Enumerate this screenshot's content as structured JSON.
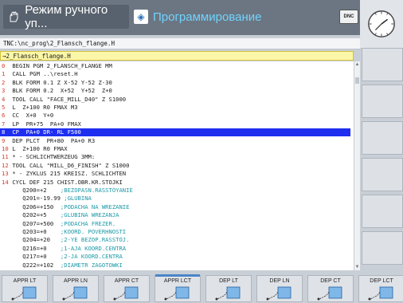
{
  "header": {
    "manual_tab": "Режим ручного уп...",
    "program_tab": "Программирование",
    "dnc": "DNC"
  },
  "path": "TNC:\\nc_prog\\2_Flansch_flange.H",
  "file": "→2_Flansch_flange.H",
  "code": [
    {
      "n": "0",
      "t": " BEGIN PGM 2_FLANSCH_FLANGE MM"
    },
    {
      "n": "1",
      "t": " CALL PGM ..\\reset.H"
    },
    {
      "n": "2",
      "t": " BLK FORM 0.1 Z X-52 Y-52 Z-30"
    },
    {
      "n": "3",
      "t": " BLK FORM 0.2  X+52  Y+52  Z+0"
    },
    {
      "n": "4",
      "t": " TOOL CALL \"FACE_MILL_D40\" Z S1000"
    },
    {
      "n": "5",
      "t": " L  Z+100 R0 FMAX M3"
    },
    {
      "n": "6",
      "t": " CC  X+0  Y+0"
    },
    {
      "n": "7",
      "t": " LP  PR+75  PA+0 FMAX"
    },
    {
      "n": "8",
      "t": " CP  PA+0 DR- RL F500"
    },
    {
      "n": "9",
      "t": " DEP PLCT  PR+80  PA+0 R3"
    },
    {
      "n": "10",
      "t": " L  Z+100 R0 FMAX"
    },
    {
      "n": "11",
      "t": " * - SCHLICHTWERZEUG 3MM:"
    },
    {
      "n": "12",
      "t": " TOOL CALL \"MILL_D6_FINISH\" Z S1000"
    },
    {
      "n": "13",
      "t": " * - ZYKLUS 215 KREISZ. SCHLICHTEN"
    },
    {
      "n": "14",
      "t": " CYCL DEF 215 CHIST.OBR.KR.STOJKI"
    },
    {
      "n": "",
      "t": "    Q200=+2    ;BEZOPASN.RASSTOYANIE"
    },
    {
      "n": "",
      "t": "    Q201=-19.99 ;GLUBINA"
    },
    {
      "n": "",
      "t": "    Q206=+150  ;PODACHA NA WREZANIE"
    },
    {
      "n": "",
      "t": "    Q202=+5    ;GLUBINA WREZANJA"
    },
    {
      "n": "",
      "t": "    Q207=+500  ;PODACHA FREZER."
    },
    {
      "n": "",
      "t": "    Q203=+0    ;KOORD. POVERHNOSTI"
    },
    {
      "n": "",
      "t": "    Q204=+20   ;2-YE BEZOP.RASSTOJ."
    },
    {
      "n": "",
      "t": "    Q216=+0    ;1-AJA KOORD.CENTRA"
    },
    {
      "n": "",
      "t": "    Q217=+0    ;2-JA KOORD.CENTRA"
    },
    {
      "n": "",
      "t": "    Q222=+102  ;DIAMETR ZAGOTOWKI"
    }
  ],
  "selected_line": 8,
  "softkeys": [
    "APPR LT",
    "APPR LN",
    "APPR CT",
    "APPR LCT",
    "DEP LT",
    "DEP LN",
    "DEP CT",
    "DEP LCT"
  ],
  "icons": {
    "manual": "hand-icon",
    "program": "edit-icon",
    "clock": "clock-icon"
  },
  "colors": {
    "selection": "#1e2ff0",
    "line_number": "#d43a2a",
    "comment": "#1d9aa8",
    "file_bar": "#fcf7a8"
  }
}
